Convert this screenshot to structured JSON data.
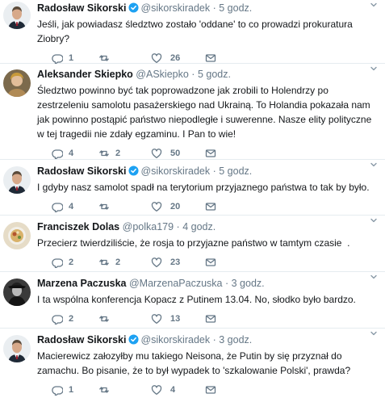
{
  "tweets": [
    {
      "author": "Radosław Sikorski",
      "verified": true,
      "handle": "@sikorskiradek",
      "separator": "·",
      "time": "5 godz.",
      "text": "Jeśli, jak powiadasz śledztwo zostało 'oddane' to co prowadzi prokuratura Ziobry?",
      "replies": "1",
      "retweets": "",
      "likes": "26",
      "avatar": "sikorski"
    },
    {
      "author": "Aleksander Skiepko",
      "verified": false,
      "handle": "@ASkiepko",
      "separator": "·",
      "time": "5 godz.",
      "text": "Śledztwo powinno być tak poprowadzone jak zrobili to Holendrzy po zestrzeleniu samolotu pasażerskiego nad Ukrainą. To Holandia pokazała nam jak powinno postąpić państwo niepodległe i suwerenne. Nasze elity polityczne w tej tragedii nie zdały egzaminu. I Pan to wie!",
      "replies": "4",
      "retweets": "2",
      "likes": "50",
      "avatar": "skiepko"
    },
    {
      "author": "Radosław Sikorski",
      "verified": true,
      "handle": "@sikorskiradek",
      "separator": "·",
      "time": "5 godz.",
      "text": "I gdyby nasz samolot spadł na terytorium przyjaznego państwa to tak by było.",
      "replies": "4",
      "retweets": "",
      "likes": "20",
      "avatar": "sikorski"
    },
    {
      "author": "Franciszek Dolas",
      "verified": false,
      "handle": "@polka179",
      "separator": "·",
      "time": "4 godz.",
      "text": "Przecierz twierdziliście, że rosja to przyjazne państwo w tamtym czasie  .",
      "replies": "2",
      "retweets": "2",
      "likes": "23",
      "avatar": "dolas"
    },
    {
      "author": "Marzena Paczuska",
      "verified": false,
      "handle": "@MarzenaPaczuska",
      "separator": "·",
      "time": "3 godz.",
      "text": "I ta wspólna konferencja Kopacz z Putinem 13.04. No, słodko było bardzo.",
      "replies": "2",
      "retweets": "",
      "likes": "13",
      "avatar": "paczuska"
    },
    {
      "author": "Radosław Sikorski",
      "verified": true,
      "handle": "@sikorskiradek",
      "separator": "·",
      "time": "3 godz.",
      "text": "Macierewicz załozyłby mu takiego Neisona, że Putin by się przyznał do zamachu. Bo pisanie, że to był wypadek to 'szkalowanie Polski', prawda?",
      "replies": "1",
      "retweets": "",
      "likes": "4",
      "avatar": "sikorski"
    }
  ],
  "colors": {
    "verified": "#1da1f2",
    "muted": "#657786",
    "text": "#14171a",
    "divider": "#e6ecf0"
  },
  "icons": {
    "reply": "reply-icon",
    "retweet": "retweet-icon",
    "like": "heart-icon",
    "dm": "envelope-icon",
    "more": "chevron-down-icon",
    "verified": "verified-badge-icon"
  }
}
